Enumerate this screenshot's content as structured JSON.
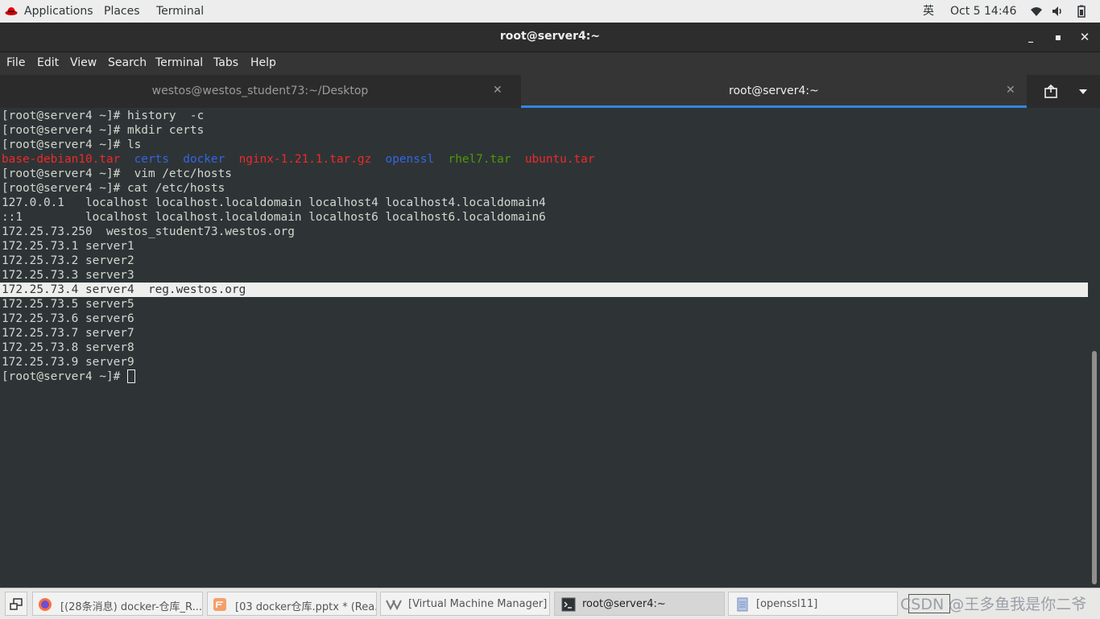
{
  "topbar": {
    "applications": "Applications",
    "places": "Places",
    "terminal": "Terminal",
    "input_method": "英",
    "datetime": "Oct 5  14:46"
  },
  "window": {
    "title": "root@server4:~"
  },
  "menu": [
    "File",
    "Edit",
    "View",
    "Search",
    "Terminal",
    "Tabs",
    "Help"
  ],
  "tabs": [
    {
      "label": "westos@westos_student73:~/Desktop",
      "active": false
    },
    {
      "label": "root@server4:~",
      "active": true
    }
  ],
  "terminal": {
    "lines": [
      "[root@server4 ~]# history  -c",
      "[root@server4 ~]# mkdir certs",
      "[root@server4 ~]# ls",
      "",
      "[root@server4 ~]#  vim /etc/hosts",
      "[root@server4 ~]# cat /etc/hosts",
      "127.0.0.1   localhost localhost.localdomain localhost4 localhost4.localdomain4",
      "::1         localhost localhost.localdomain localhost6 localhost6.localdomain6",
      "172.25.73.250  westos_student73.westos.org",
      "172.25.73.1 server1",
      "172.25.73.2 server2",
      "172.25.73.3 server3",
      "172.25.73.4 server4  reg.westos.org",
      "172.25.73.5 server5",
      "172.25.73.6 server6",
      "172.25.73.7 server7",
      "172.25.73.8 server8",
      "172.25.73.9 server9",
      "[root@server4 ~]# "
    ],
    "ls_output": [
      {
        "name": "base-debian10.tar",
        "color": "#ef2929"
      },
      {
        "name": "certs",
        "color": "#3465e4"
      },
      {
        "name": "docker",
        "color": "#3465e4"
      },
      {
        "name": "nginx-1.21.1.tar.gz",
        "color": "#ef2929"
      },
      {
        "name": "openssl",
        "color": "#3465e4"
      },
      {
        "name": "rhel7.tar",
        "color": "#4e9a06"
      },
      {
        "name": "ubuntu.tar",
        "color": "#ef2929"
      }
    ],
    "highlighted_line_index": 12
  },
  "taskbar": {
    "items": [
      {
        "label": "[(28条消息) docker-仓库_R...",
        "icon": "firefox-icon",
        "active": false
      },
      {
        "label": "[03 docker仓库.pptx * (Rea...",
        "icon": "presentation-icon",
        "active": false
      },
      {
        "label": "[Virtual Machine Manager]",
        "icon": "virt-manager-icon",
        "active": false
      },
      {
        "label": "root@server4:~",
        "icon": "terminal-icon",
        "active": true
      },
      {
        "label": "[openssl11]",
        "icon": "file-manager-icon",
        "active": false
      }
    ],
    "watermark": "CSDN @王多鱼我是你二爷"
  },
  "colors": {
    "terminal_bg": "#2e3436",
    "terminal_fg": "#d3d7cf",
    "tab_accent": "#3584e4"
  }
}
